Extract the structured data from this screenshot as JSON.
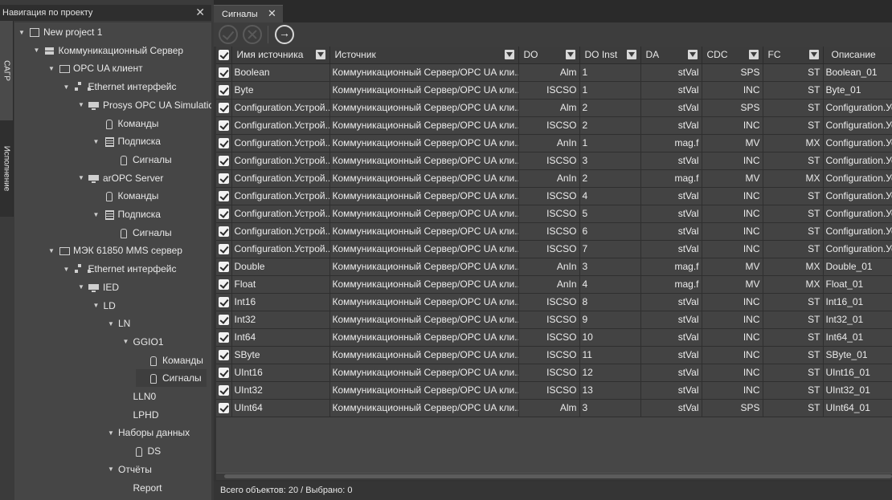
{
  "nav": {
    "title": "Навигация по проекту",
    "close_glyph": "✕",
    "side_tabs": [
      "САГР",
      "Исполнение"
    ],
    "tree": [
      {
        "label": "New project 1",
        "level": 0,
        "icon": "project-icon",
        "arrow": "▼"
      },
      {
        "label": "Коммуникационный Сервер",
        "level": 1,
        "icon": "server-icon",
        "arrow": "▼"
      },
      {
        "label": "OPC UA клиент",
        "level": 2,
        "icon": "client-icon",
        "arrow": "▼"
      },
      {
        "label": "Ethernet интерфейс",
        "level": 3,
        "icon": "network-icon",
        "arrow": "▼"
      },
      {
        "label": "Prosys OPC UA Simulation",
        "level": 4,
        "icon": "device-icon",
        "arrow": "▼"
      },
      {
        "label": "Команды",
        "level": 5,
        "icon": "tag-icon",
        "arrow": ""
      },
      {
        "label": "Подписка",
        "level": 5,
        "icon": "list-icon",
        "arrow": "▼"
      },
      {
        "label": "Сигналы",
        "level": 6,
        "icon": "tag-icon",
        "arrow": ""
      },
      {
        "label": "arOPC Server",
        "level": 4,
        "icon": "device-icon",
        "arrow": "▼"
      },
      {
        "label": "Команды",
        "level": 5,
        "icon": "tag-icon",
        "arrow": ""
      },
      {
        "label": "Подписка",
        "level": 5,
        "icon": "list-icon",
        "arrow": "▼"
      },
      {
        "label": "Сигналы",
        "level": 6,
        "icon": "tag-icon",
        "arrow": ""
      },
      {
        "label": "МЭК 61850 MMS сервер",
        "level": 2,
        "icon": "mms-icon",
        "arrow": "▼"
      },
      {
        "label": "Ethernet интерфейс",
        "level": 3,
        "icon": "network-icon",
        "arrow": "▼"
      },
      {
        "label": "IED",
        "level": 4,
        "icon": "device-icon",
        "arrow": "▼"
      },
      {
        "label": "LD",
        "level": 5,
        "icon": "",
        "arrow": "▼"
      },
      {
        "label": "LN",
        "level": 6,
        "icon": "",
        "arrow": "▼"
      },
      {
        "label": "GGIO1",
        "level": 7,
        "icon": "",
        "arrow": "▼"
      },
      {
        "label": "Команды",
        "level": 8,
        "icon": "tag-icon",
        "arrow": ""
      },
      {
        "label": "Сигналы",
        "level": 8,
        "icon": "tag-icon",
        "arrow": "",
        "selected": true
      },
      {
        "label": "LLN0",
        "level": 7,
        "icon": "",
        "arrow": ""
      },
      {
        "label": "LPHD",
        "level": 7,
        "icon": "",
        "arrow": ""
      },
      {
        "label": "Наборы данных",
        "level": 6,
        "icon": "",
        "arrow": "▼"
      },
      {
        "label": "DS",
        "level": 7,
        "icon": "tag-icon",
        "arrow": ""
      },
      {
        "label": "Отчёты",
        "level": 6,
        "icon": "",
        "arrow": "▼"
      },
      {
        "label": "Report",
        "level": 7,
        "icon": "",
        "arrow": ""
      }
    ]
  },
  "tab": {
    "label": "Сигналы",
    "close_glyph": "✕"
  },
  "toolbar": {
    "buttons": [
      "ok-icon",
      "cancel-icon",
      "export-icon"
    ]
  },
  "table": {
    "columns": [
      "Имя источника",
      "Источник",
      "DO",
      "DO Inst",
      "DA",
      "CDC",
      "FC",
      "Описание"
    ],
    "rows": [
      [
        "Boolean",
        "Коммуникационный Сервер/OPC UA кли...",
        "Alm",
        "1",
        "stVal",
        "SPS",
        "ST",
        "Boolean_01"
      ],
      [
        "Byte",
        "Коммуникационный Сервер/OPC UA кли...",
        "ISCSO",
        "1",
        "stVal",
        "INC",
        "ST",
        "Byte_01"
      ],
      [
        "Configuration.Устрой...",
        "Коммуникационный Сервер/OPC UA кли...",
        "Alm",
        "2",
        "stVal",
        "SPS",
        "ST",
        "Configuration.Ус"
      ],
      [
        "Configuration.Устрой...",
        "Коммуникационный Сервер/OPC UA кли...",
        "ISCSO",
        "2",
        "stVal",
        "INC",
        "ST",
        "Configuration.Ус"
      ],
      [
        "Configuration.Устрой...",
        "Коммуникационный Сервер/OPC UA кли...",
        "AnIn",
        "1",
        "mag.f",
        "MV",
        "MX",
        "Configuration.Ус"
      ],
      [
        "Configuration.Устрой...",
        "Коммуникационный Сервер/OPC UA кли...",
        "ISCSO",
        "3",
        "stVal",
        "INC",
        "ST",
        "Configuration.Ус"
      ],
      [
        "Configuration.Устрой...",
        "Коммуникационный Сервер/OPC UA кли...",
        "AnIn",
        "2",
        "mag.f",
        "MV",
        "MX",
        "Configuration.Ус"
      ],
      [
        "Configuration.Устрой...",
        "Коммуникационный Сервер/OPC UA кли...",
        "ISCSO",
        "4",
        "stVal",
        "INC",
        "ST",
        "Configuration.Ус"
      ],
      [
        "Configuration.Устрой...",
        "Коммуникационный Сервер/OPC UA кли...",
        "ISCSO",
        "5",
        "stVal",
        "INC",
        "ST",
        "Configuration.Ус"
      ],
      [
        "Configuration.Устрой...",
        "Коммуникационный Сервер/OPC UA кли...",
        "ISCSO",
        "6",
        "stVal",
        "INC",
        "ST",
        "Configuration.Ус"
      ],
      [
        "Configuration.Устрой...",
        "Коммуникационный Сервер/OPC UA кли...",
        "ISCSO",
        "7",
        "stVal",
        "INC",
        "ST",
        "Configuration.Ус"
      ],
      [
        "Double",
        "Коммуникационный Сервер/OPC UA кли...",
        "AnIn",
        "3",
        "mag.f",
        "MV",
        "MX",
        "Double_01"
      ],
      [
        "Float",
        "Коммуникационный Сервер/OPC UA кли...",
        "AnIn",
        "4",
        "mag.f",
        "MV",
        "MX",
        "Float_01"
      ],
      [
        "Int16",
        "Коммуникационный Сервер/OPC UA кли...",
        "ISCSO",
        "8",
        "stVal",
        "INC",
        "ST",
        "Int16_01"
      ],
      [
        "Int32",
        "Коммуникационный Сервер/OPC UA кли...",
        "ISCSO",
        "9",
        "stVal",
        "INC",
        "ST",
        "Int32_01"
      ],
      [
        "Int64",
        "Коммуникационный Сервер/OPC UA кли...",
        "ISCSO",
        "10",
        "stVal",
        "INC",
        "ST",
        "Int64_01"
      ],
      [
        "SByte",
        "Коммуникационный Сервер/OPC UA кли...",
        "ISCSO",
        "11",
        "stVal",
        "INC",
        "ST",
        "SByte_01"
      ],
      [
        "UInt16",
        "Коммуникационный Сервер/OPC UA кли...",
        "ISCSO",
        "12",
        "stVal",
        "INC",
        "ST",
        "UInt16_01"
      ],
      [
        "UInt32",
        "Коммуникационный Сервер/OPC UA кли...",
        "ISCSO",
        "13",
        "stVal",
        "INC",
        "ST",
        "UInt32_01"
      ],
      [
        "UInt64",
        "Коммуникационный Сервер/OPC UA кли...",
        "Alm",
        "3",
        "stVal",
        "SPS",
        "ST",
        "UInt64_01"
      ]
    ]
  },
  "status": {
    "text": "Всего объектов: 20 / Выбрано: 0"
  }
}
